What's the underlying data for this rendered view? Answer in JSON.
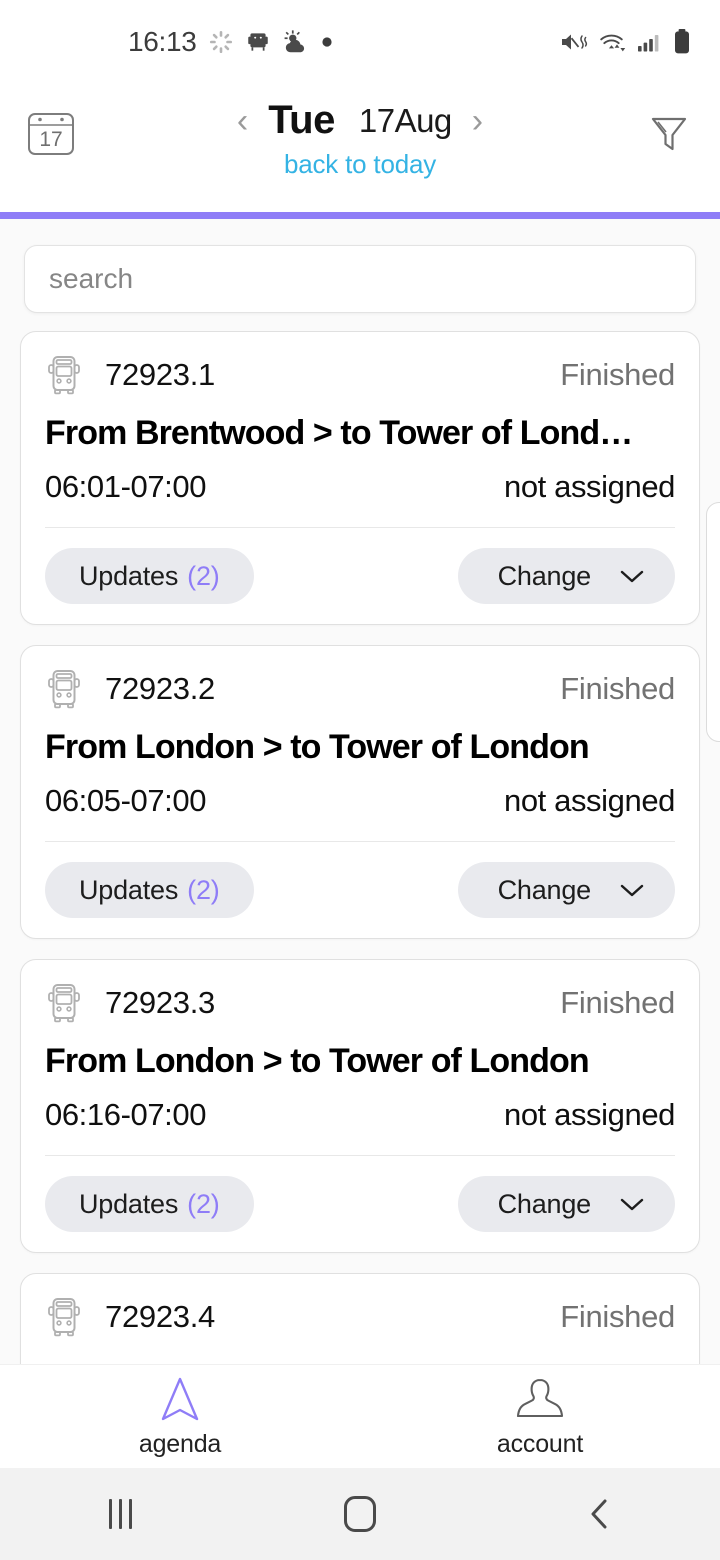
{
  "status_bar": {
    "time": "16:13",
    "left_icons": [
      "loading-spinner-icon",
      "sofa-icon",
      "weather-partly-sunny-icon",
      "dot-icon"
    ],
    "right_icons": [
      "mute-vibrate-icon",
      "wifi-icon",
      "signal-bars-icon",
      "battery-icon"
    ]
  },
  "header": {
    "calendar_day": "17",
    "prev_arrow": "‹",
    "next_arrow": "›",
    "day_name": "Tue",
    "date": "17Aug",
    "back_to_today": "back to today",
    "filter_icon": "filter-funnel-icon",
    "accent_color": "#8f7df7"
  },
  "search": {
    "placeholder": "search",
    "value": ""
  },
  "trips": [
    {
      "id": "72923.1",
      "status": "Finished",
      "route": "From Brentwood > to Tower of Lond…",
      "time": "06:01-07:00",
      "assignment": "not assigned",
      "updates_label": "Updates",
      "updates_count": "(2)",
      "change_label": "Change"
    },
    {
      "id": "72923.2",
      "status": "Finished",
      "route": "From London > to Tower of London",
      "time": "06:05-07:00",
      "assignment": "not assigned",
      "updates_label": "Updates",
      "updates_count": "(2)",
      "change_label": "Change"
    },
    {
      "id": "72923.3",
      "status": "Finished",
      "route": "From London > to Tower of London",
      "time": "06:16-07:00",
      "assignment": "not assigned",
      "updates_label": "Updates",
      "updates_count": "(2)",
      "change_label": "Change"
    },
    {
      "id": "72923.4",
      "status": "Finished"
    }
  ],
  "bottom_nav": {
    "items": [
      {
        "label": "agenda",
        "icon": "navigation-arrow-icon",
        "active": true
      },
      {
        "label": "account",
        "icon": "person-icon",
        "active": false
      }
    ],
    "active_color": "#8f7df7"
  },
  "android_nav": {
    "recents": "recents-icon",
    "home": "home-icon",
    "back": "back-icon"
  },
  "colors": {
    "accent_purple": "#8f7df7",
    "link_blue": "#34b3e4",
    "status_grey": "#727272",
    "pill_bg": "#e9eaee",
    "page_bg": "#fafafa"
  }
}
